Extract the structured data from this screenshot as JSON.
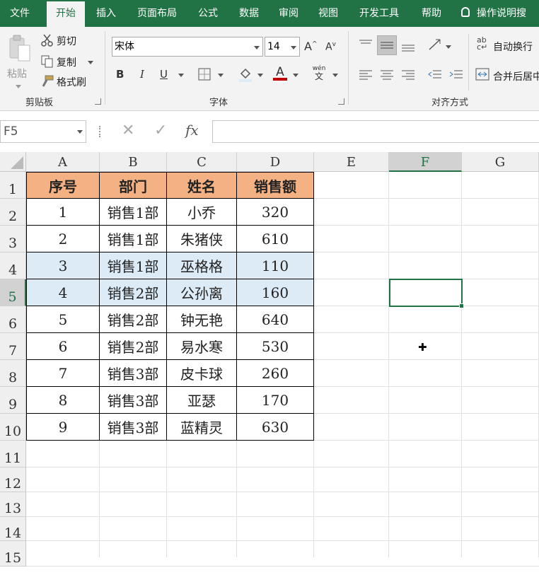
{
  "ribbon_tabs": [
    "文件",
    "开始",
    "插入",
    "页面布局",
    "公式",
    "数据",
    "审阅",
    "视图",
    "开发工具",
    "帮助"
  ],
  "active_tab": "开始",
  "tell_me": "操作说明搜",
  "clipboard": {
    "paste": "粘贴",
    "cut": "剪切",
    "copy": "复制",
    "format_painter": "格式刷",
    "group": "剪贴板"
  },
  "font": {
    "name": "宋体",
    "size": "14",
    "group": "字体",
    "bold": "B",
    "italic": "I",
    "underline": "U",
    "grow": "A",
    "shrink": "A",
    "font_color": "A",
    "phonetic_top": "wén",
    "phonetic_bottom": "文"
  },
  "alignment": {
    "wrap": "自动换行",
    "merge": "合并后居中",
    "group": "对齐方式"
  },
  "formula_bar": {
    "name_box": "F5",
    "fx": "fx",
    "value": ""
  },
  "columns": [
    "A",
    "B",
    "C",
    "D",
    "E",
    "F",
    "G"
  ],
  "selected_column": "F",
  "rows": [
    "1",
    "2",
    "3",
    "4",
    "5",
    "6",
    "7",
    "8",
    "9",
    "10",
    "11",
    "12",
    "13",
    "14",
    "15"
  ],
  "selected_row": "5",
  "table": {
    "headers": [
      "序号",
      "部门",
      "姓名",
      "销售额"
    ],
    "rows": [
      [
        "1",
        "销售1部",
        "小乔",
        "320"
      ],
      [
        "2",
        "销售1部",
        "朱猪侠",
        "610"
      ],
      [
        "3",
        "销售1部",
        "巫格格",
        "110"
      ],
      [
        "4",
        "销售2部",
        "公孙离",
        "160"
      ],
      [
        "5",
        "销售2部",
        "钟无艳",
        "640"
      ],
      [
        "6",
        "销售2部",
        "易水寒",
        "530"
      ],
      [
        "7",
        "销售3部",
        "皮卡球",
        "260"
      ],
      [
        "8",
        "销售3部",
        "亚瑟",
        "170"
      ],
      [
        "9",
        "销售3部",
        "蓝精灵",
        "630"
      ]
    ]
  },
  "colors": {
    "header_fill": "#f4b183",
    "highlight_fill": "#ddebf7",
    "accent": "#217346"
  }
}
